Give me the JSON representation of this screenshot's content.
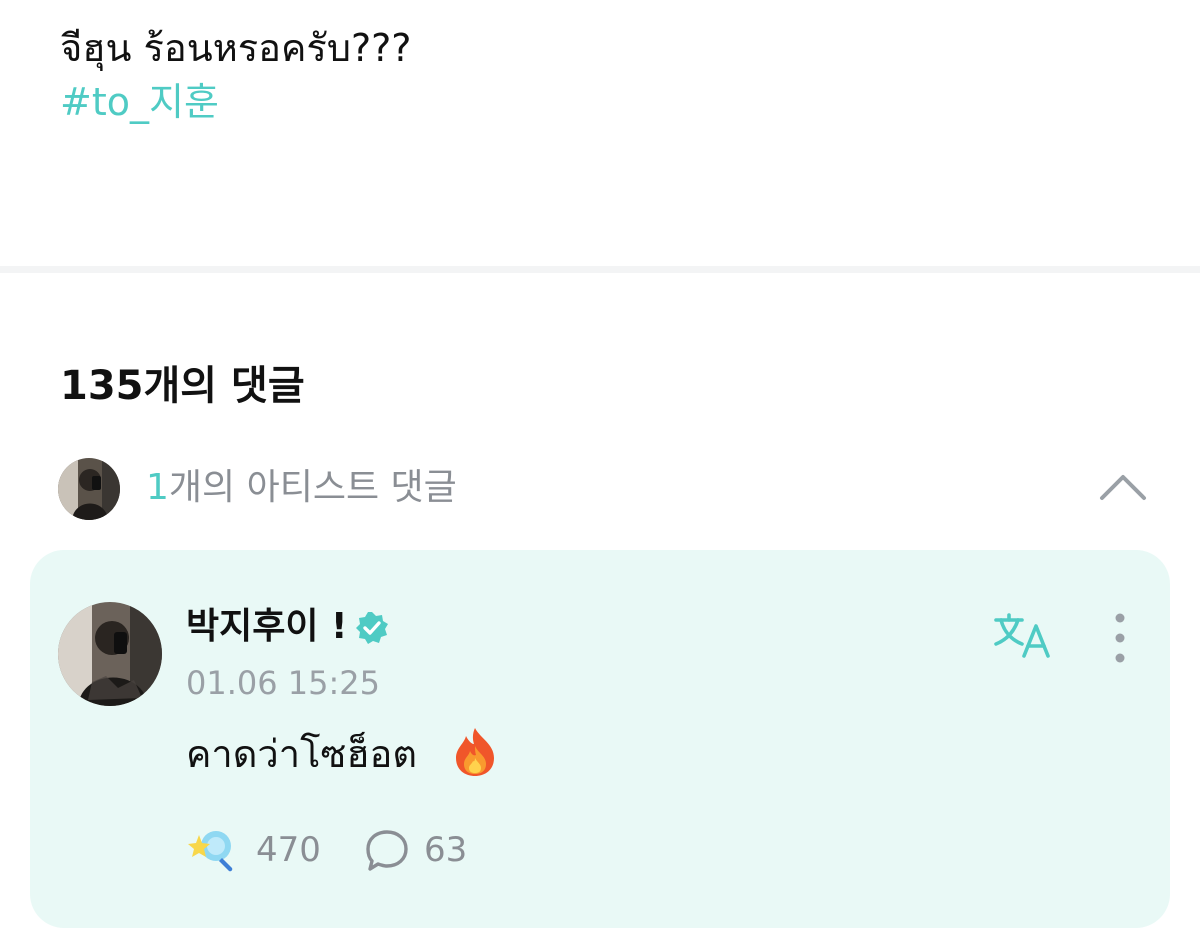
{
  "post": {
    "text": "จีฮุน ร้อนหรอครับ???",
    "hashtag": "#to_지훈"
  },
  "comments_header": {
    "title": "135개의 댓글"
  },
  "artist_comments": {
    "count": "1",
    "label": "개의 아티스트 댓글",
    "avatar_icon": "artist-avatar-photo",
    "collapse_icon": "chevron-up-icon"
  },
  "comment": {
    "author": "박지후이 !",
    "verified_icon": "verified-badge-icon",
    "timestamp": "01.06 15:25",
    "body": "คาดว่าโซฮ็อต",
    "emoji_icon": "fire-icon",
    "likes": "470",
    "replies": "63",
    "translate_icon": "translate-icon",
    "more_icon": "more-vertical-icon"
  },
  "colors": {
    "accent": "#4fcbc4",
    "card_background": "#e9f9f6",
    "muted_text": "#8a8e94",
    "divider": "#f3f4f5"
  }
}
